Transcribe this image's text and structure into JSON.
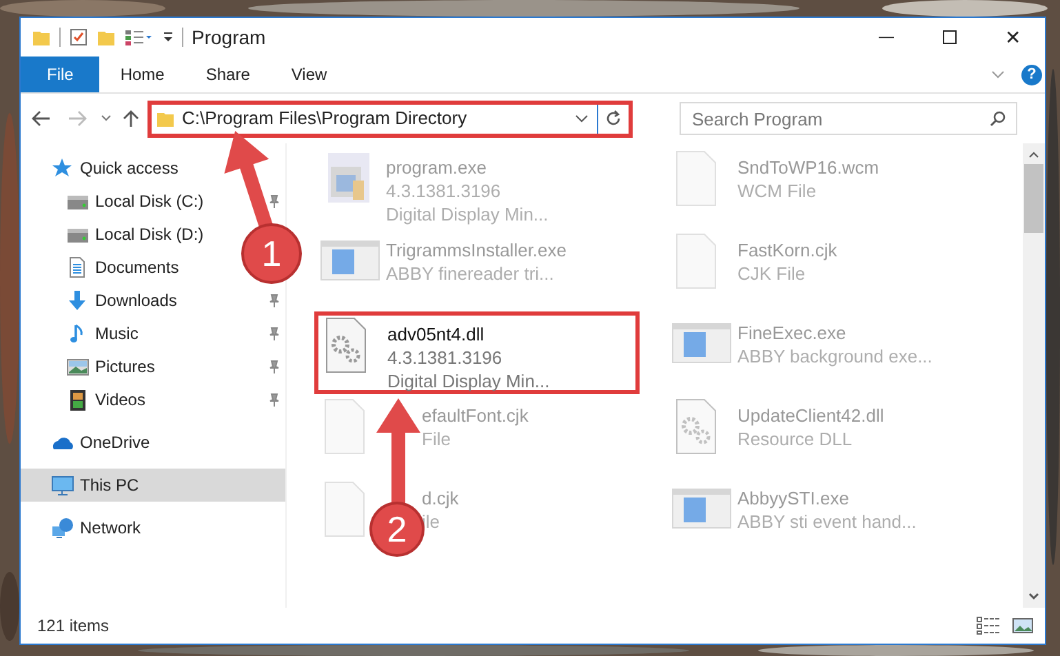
{
  "window": {
    "title": "Program",
    "minimize": "—",
    "close": "✕"
  },
  "ribbon": {
    "tabs": [
      {
        "label": "File",
        "selected": true
      },
      {
        "label": "Home",
        "selected": false
      },
      {
        "label": "Share",
        "selected": false
      },
      {
        "label": "View",
        "selected": false
      }
    ],
    "help": "?"
  },
  "address_bar": {
    "path": "C:\\Program Files\\Program Directory",
    "outlined": true
  },
  "search": {
    "placeholder": "Search Program"
  },
  "sidebar": {
    "items": [
      {
        "label": "Quick access",
        "kind": "star",
        "selected": false,
        "children": [
          {
            "label": "Local Disk (C:)",
            "kind": "drive",
            "pinned": true,
            "selected": false
          },
          {
            "label": "Local Disk (D:)",
            "kind": "drive",
            "selected": false
          },
          {
            "label": "Documents",
            "kind": "documents",
            "selected": false
          },
          {
            "label": "Downloads",
            "kind": "downloads",
            "pinned": true,
            "selected": false
          },
          {
            "label": "Music",
            "kind": "music",
            "pinned": true,
            "selected": false
          },
          {
            "label": "Pictures",
            "kind": "pictures",
            "pinned": true,
            "selected": false
          },
          {
            "label": "Videos",
            "kind": "videos",
            "pinned": true,
            "selected": false
          }
        ]
      },
      {
        "label": "OneDrive",
        "kind": "cloud",
        "selected": false
      },
      {
        "label": "This PC",
        "kind": "pc",
        "selected": true
      },
      {
        "label": "Network",
        "kind": "network",
        "selected": false
      }
    ]
  },
  "files": [
    {
      "name": "program.exe",
      "lines": [
        "4.3.1381.3196",
        "Digital Display Min..."
      ],
      "kind": "installer",
      "blurred": true,
      "outlined": false
    },
    {
      "name": "SndToWP16.wcm",
      "lines": [
        "WCM File"
      ],
      "kind": "document",
      "blurred": true,
      "outlined": false
    },
    {
      "name": "TrigrammsInstaller.exe",
      "lines": [
        "ABBY finereader tri..."
      ],
      "kind": "app",
      "blurred": true,
      "outlined": false
    },
    {
      "name": "FastKorn.cjk",
      "lines": [
        "CJK File"
      ],
      "kind": "document",
      "blurred": true,
      "outlined": false
    },
    {
      "name": "adv05nt4.dll",
      "lines": [
        "4.3.1381.3196",
        "Digital Display Min..."
      ],
      "kind": "dll",
      "blurred": false,
      "outlined": true
    },
    {
      "name": "FineExec.exe",
      "lines": [
        "ABBY background exe..."
      ],
      "kind": "app",
      "blurred": true,
      "outlined": false
    },
    {
      "name": "efaultFont.cjk",
      "lines": [
        "File"
      ],
      "kind": "document",
      "blurred": true,
      "outlined": false,
      "covered_by_arrow": true
    },
    {
      "name": "UpdateClient42.dll",
      "lines": [
        "Resource DLL"
      ],
      "kind": "dll",
      "blurred": true,
      "outlined": false
    },
    {
      "name": "d.cjk",
      "lines": [
        "ile"
      ],
      "kind": "document",
      "blurred": true,
      "outlined": false,
      "covered_by_arrow": true
    },
    {
      "name": "AbbyySTI.exe",
      "lines": [
        "ABBY sti event hand..."
      ],
      "kind": "app",
      "blurred": true,
      "outlined": false
    }
  ],
  "status_bar": {
    "count": "121 items"
  },
  "annotations": [
    {
      "number": "1"
    },
    {
      "number": "2"
    }
  ]
}
